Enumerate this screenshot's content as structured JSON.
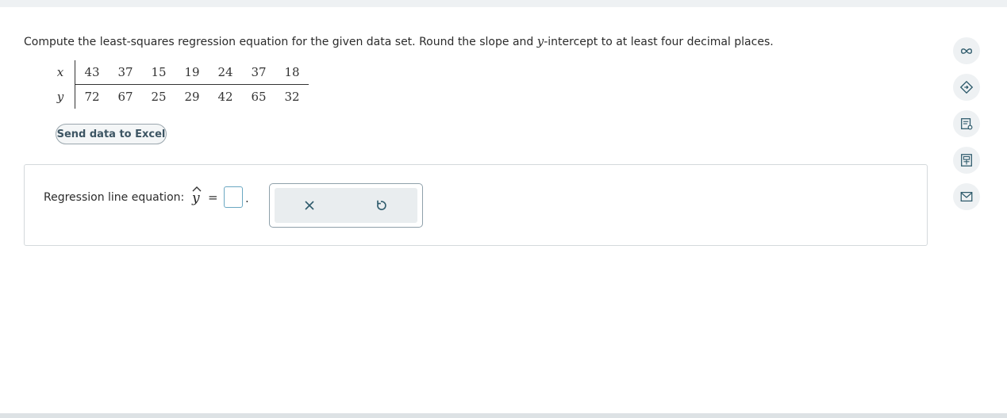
{
  "question": {
    "prompt_pre": "Compute the least-squares regression equation for the given data set. Round the slope and ",
    "prompt_var": "y",
    "prompt_post": "-intercept to at least four decimal places."
  },
  "data_table": {
    "x_label": "x",
    "y_label": "y",
    "x_values": [
      "43",
      "37",
      "15",
      "19",
      "24",
      "37",
      "18"
    ],
    "y_values": [
      "72",
      "67",
      "25",
      "29",
      "42",
      "65",
      "32"
    ]
  },
  "excel_button": {
    "label": "Send data to Excel"
  },
  "answer": {
    "equation_label": "Regression line equation:",
    "yhat_var": "y",
    "equals": "=",
    "input_value": "",
    "period": "."
  },
  "toolbox": {
    "clear_icon": "close-icon",
    "reset_icon": "undo-icon"
  },
  "side_tools": [
    {
      "name": "infinity-icon"
    },
    {
      "name": "guided-solution-icon"
    },
    {
      "name": "textbook-icon"
    },
    {
      "name": "calculator-icon"
    },
    {
      "name": "mail-icon"
    }
  ],
  "colors": {
    "input_border": "#6aa7c2",
    "button_text": "#3d5563",
    "icon_color": "#2d5a6b",
    "side_bg": "#eef1f3"
  }
}
